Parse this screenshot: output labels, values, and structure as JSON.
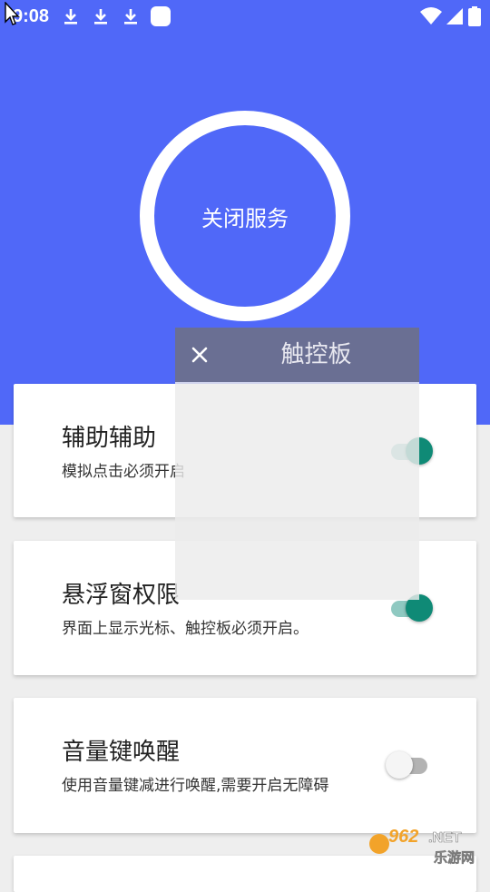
{
  "status_bar": {
    "time": "9:08",
    "icons": [
      "download-icon",
      "download-icon",
      "download-icon",
      "app-square-icon",
      "wifi-icon",
      "signal-icon",
      "battery-icon"
    ]
  },
  "colors": {
    "accent": "#5068f8",
    "toggle_on": "#0f8a76",
    "toggle_on_track": "#8fc9c1",
    "toggle_off_track": "#b3b3b3",
    "background": "#eeeeee"
  },
  "service_button": {
    "label": "关闭服务"
  },
  "settings": [
    {
      "title": "辅助辅助",
      "description": "模拟点击必须开启",
      "enabled": true
    },
    {
      "title": "悬浮窗权限",
      "description": "界面上显示光标、触控板必须开启。",
      "enabled": true
    },
    {
      "title": "音量键唤醒",
      "description": "使用音量键减进行唤醒,需要开启无障碍",
      "enabled": false
    }
  ],
  "touchpad_overlay": {
    "title": "触控板",
    "close_icon": "close-icon"
  },
  "watermark": {
    "text_top": "962.NET",
    "text_bottom": "乐游网"
  }
}
